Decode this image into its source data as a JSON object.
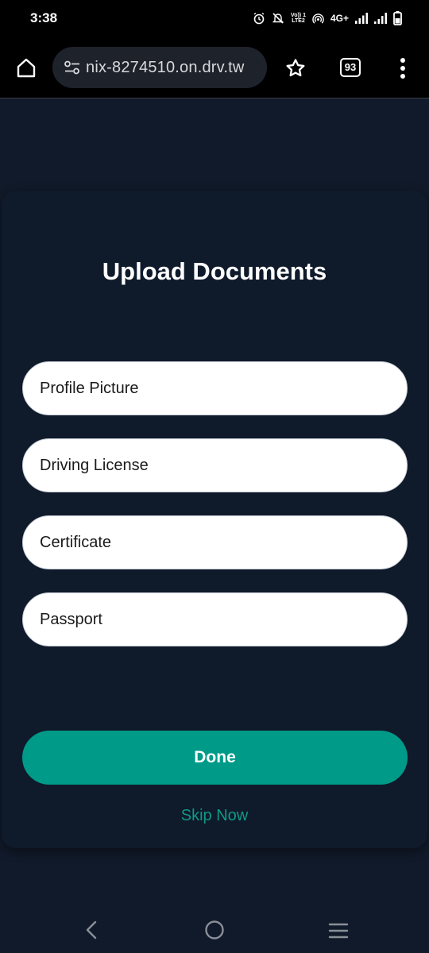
{
  "status_bar": {
    "time": "3:38",
    "network": "4G+",
    "volte_top": "Vo)) 1",
    "volte_bottom": "LTE2",
    "icons": [
      "alarm-icon",
      "silent-bell-icon",
      "volte-icon",
      "hotspot-icon",
      "signal-icon",
      "signal-icon",
      "battery-icon"
    ]
  },
  "browser": {
    "url": "nix-8274510.on.drv.tw",
    "tab_count": "93",
    "icons": [
      "home-icon",
      "site-settings-icon",
      "star-icon",
      "tabs-icon",
      "more-vert-icon"
    ]
  },
  "main": {
    "title": "Upload Documents",
    "fields": [
      {
        "label": "Profile Picture"
      },
      {
        "label": "Driving License"
      },
      {
        "label": "Certificate"
      },
      {
        "label": "Passport"
      }
    ],
    "done_label": "Done",
    "skip_label": "Skip Now"
  },
  "nav_bar": {
    "icons": [
      "back-icon",
      "home-circle-icon",
      "recent-apps-icon"
    ]
  },
  "colors": {
    "background": "#111a2a",
    "accent": "#009a88",
    "skip_text": "#0e9a86",
    "field_bg": "#ffffff"
  }
}
